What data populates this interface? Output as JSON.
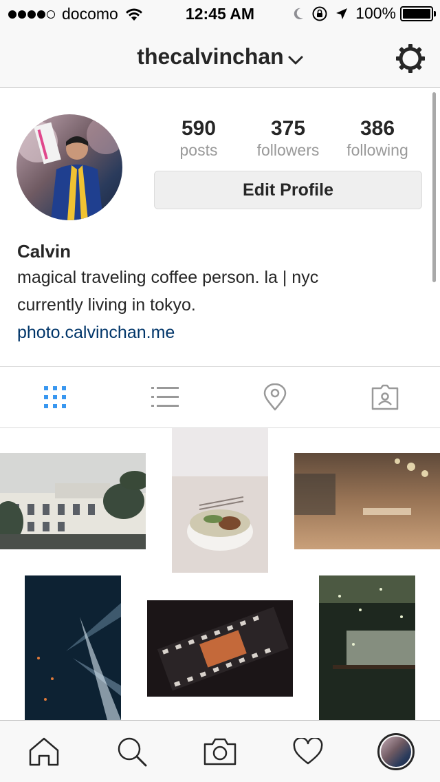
{
  "status_bar": {
    "carrier": "docomo",
    "time": "12:45 AM",
    "battery": "100%",
    "signal_bars": 4,
    "icons": [
      "signal-dots-icon",
      "wifi-icon",
      "moon-icon",
      "rotation-lock-icon",
      "location-arrow-icon",
      "battery-icon"
    ]
  },
  "nav": {
    "username": "thecalvinchan",
    "icons": [
      "chevron-down-icon",
      "gear-icon"
    ]
  },
  "profile": {
    "stats": [
      {
        "value": "590",
        "label": "posts"
      },
      {
        "value": "375",
        "label": "followers"
      },
      {
        "value": "386",
        "label": "following"
      }
    ],
    "edit_button": "Edit Profile",
    "name": "Calvin",
    "bio_lines": [
      "magical traveling coffee person. la | nyc",
      "currently living in tokyo."
    ],
    "link": "photo.calvinchan.me"
  },
  "tabs": [
    {
      "name": "grid-view-icon",
      "active": true
    },
    {
      "name": "list-view-icon",
      "active": false
    },
    {
      "name": "location-pin-icon",
      "active": false
    },
    {
      "name": "tagged-photos-icon",
      "active": false
    }
  ],
  "colors": {
    "accent": "#3897f0",
    "link": "#003569",
    "text": "#262626",
    "muted": "#999999",
    "bar_bg": "#f8f8f8"
  },
  "bottom_tabs": [
    "home-icon",
    "search-icon",
    "camera-icon",
    "heart-icon",
    "profile-avatar"
  ]
}
